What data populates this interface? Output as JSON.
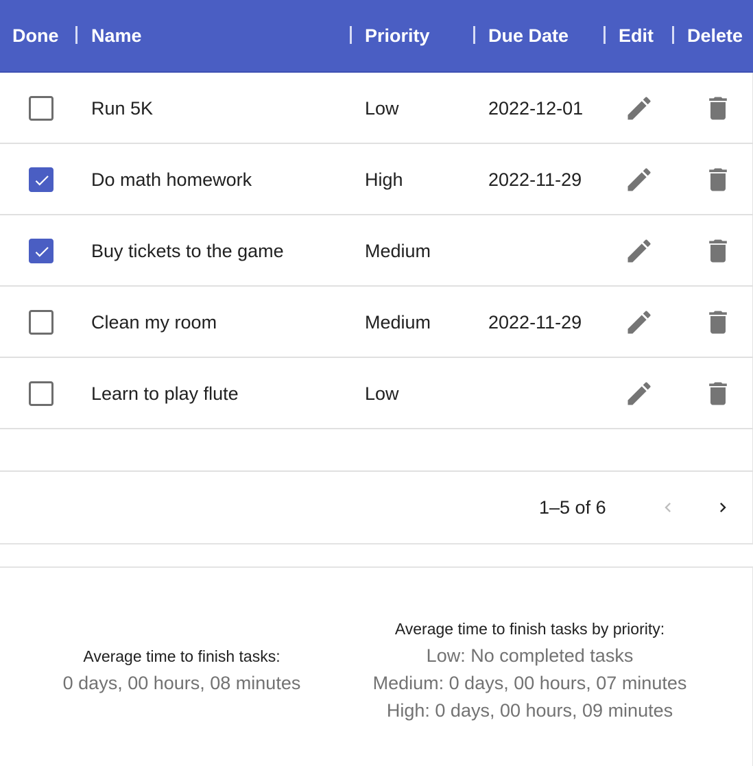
{
  "table": {
    "headers": {
      "done": "Done",
      "name": "Name",
      "priority": "Priority",
      "due_date": "Due Date",
      "edit": "Edit",
      "delete": "Delete"
    },
    "rows": [
      {
        "done": false,
        "name": "Run 5K",
        "priority": "Low",
        "due_date": "2022-12-01"
      },
      {
        "done": true,
        "name": "Do math homework",
        "priority": "High",
        "due_date": "2022-11-29"
      },
      {
        "done": true,
        "name": "Buy tickets to the game",
        "priority": "Medium",
        "due_date": ""
      },
      {
        "done": false,
        "name": "Clean my room",
        "priority": "Medium",
        "due_date": "2022-11-29"
      },
      {
        "done": false,
        "name": "Learn to play flute",
        "priority": "Low",
        "due_date": ""
      }
    ],
    "icons": {
      "edit": "pencil-icon",
      "delete": "trash-icon",
      "checked": "checkmark-icon"
    }
  },
  "pagination": {
    "range_text": "1–5 of 6",
    "prev_icon": "chevron-left-icon",
    "next_icon": "chevron-right-icon",
    "prev_enabled": false,
    "next_enabled": true
  },
  "stats": {
    "average": {
      "title": "Average time to finish tasks:",
      "value": "0 days, 00 hours, 08 minutes"
    },
    "by_priority": {
      "title": "Average time to finish tasks by priority:",
      "low": "Low: No completed tasks",
      "medium": "Medium: 0 days, 00 hours, 07 minutes",
      "high": "High: 0 days, 00 hours, 09 minutes"
    }
  },
  "colors": {
    "header_bg": "#4a5ec3",
    "checkbox_checked": "#4a5ec3",
    "icon_gray": "#757575",
    "muted_text": "#727272"
  }
}
